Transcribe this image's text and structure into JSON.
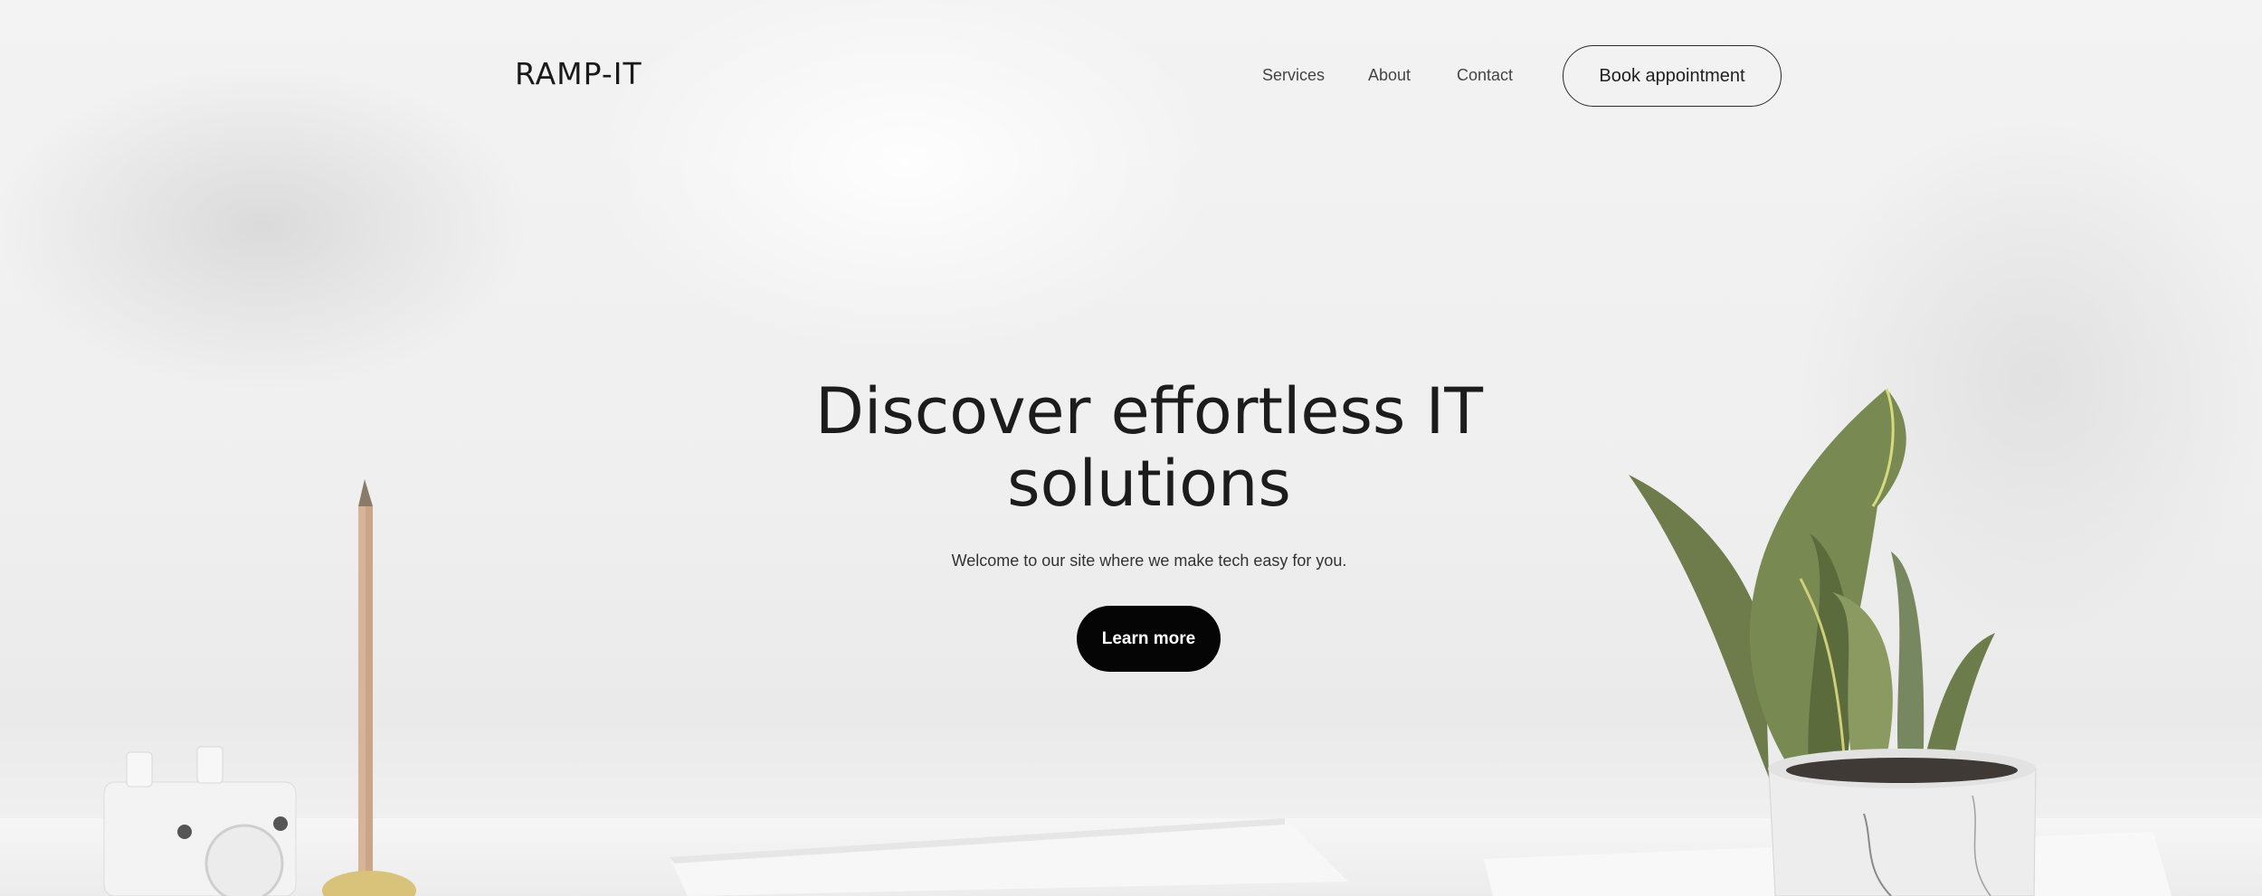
{
  "header": {
    "brand": "RAMP-IT",
    "nav": {
      "services": "Services",
      "about": "About",
      "contact": "Contact"
    },
    "cta": "Book appointment"
  },
  "hero": {
    "title_line1": "Discover effortless IT",
    "title_line2": "solutions",
    "subtitle": "Welcome to our site where we make tech easy for you.",
    "button": "Learn more"
  },
  "colors": {
    "background": "#f1f1f1",
    "text": "#1c1c1c",
    "button_dark": "#050505",
    "plant_green": "#6f7f4c"
  },
  "icons": {
    "plant": "snake-plant-illustration",
    "pencil": "pencil-illustration",
    "device": "white-speaker-illustration"
  }
}
